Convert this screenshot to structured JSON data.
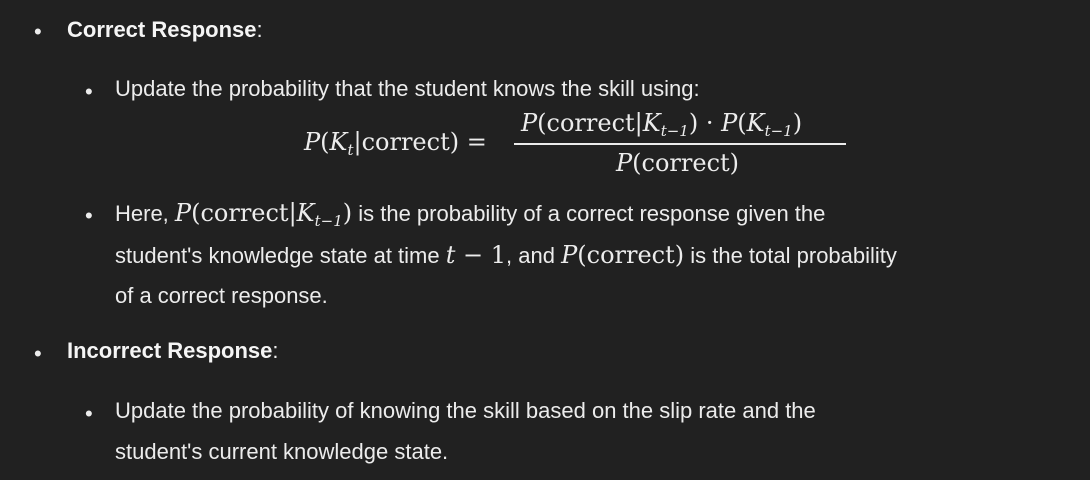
{
  "items": [
    {
      "heading": "Correct Response",
      "colon": ":",
      "sub": [
        {
          "text": "Update the probability that the student knows the skill using:"
        },
        {
          "lead": "Here, ",
          "mid1": " is the probability of a correct response given the",
          "line2_a": "student's knowledge state at time ",
          "line2_b": ", and ",
          "line2_c": " is the total probability",
          "line3": "of a correct response."
        }
      ]
    },
    {
      "heading": "Incorrect Response",
      "colon": ":",
      "sub": [
        {
          "line1": "Update the probability of knowing the skill based on the slip rate and the",
          "line2": "student's current knowledge state."
        }
      ]
    }
  ],
  "math": {
    "bullet": "•",
    "P": "P",
    "K": "K",
    "t": "t",
    "tm1": "t−1",
    "one": "1",
    "minus": " − ",
    "correct": "correct",
    "bar": "|",
    "cdot": " · ",
    "eq": "=",
    "lp": "(",
    "rp": ")"
  }
}
